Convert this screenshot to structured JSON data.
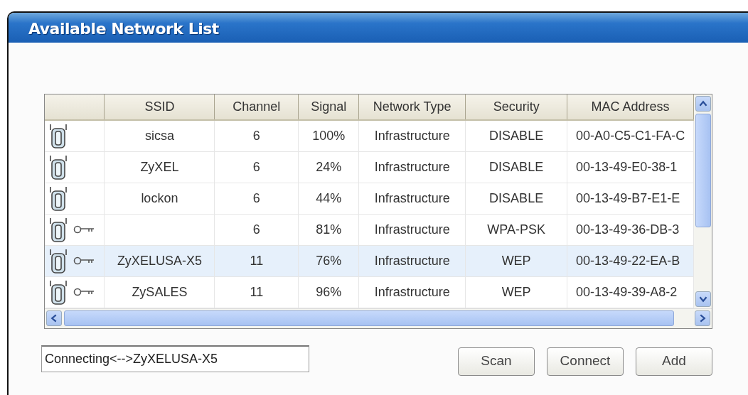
{
  "window": {
    "title": "Available Network List"
  },
  "table": {
    "columns": [
      "SSID",
      "Channel",
      "Signal",
      "Network Type",
      "Security",
      "MAC Address"
    ],
    "rows": [
      {
        "ssid": "sicsa",
        "channel": "6",
        "signal": "100%",
        "network_type": "Infrastructure",
        "security": "DISABLE",
        "mac": "00-A0-C5-C1-FA-C",
        "encrypted": false,
        "selected": false
      },
      {
        "ssid": "ZyXEL",
        "channel": "6",
        "signal": "24%",
        "network_type": "Infrastructure",
        "security": "DISABLE",
        "mac": "00-13-49-E0-38-1",
        "encrypted": false,
        "selected": false
      },
      {
        "ssid": "lockon",
        "channel": "6",
        "signal": "44%",
        "network_type": "Infrastructure",
        "security": "DISABLE",
        "mac": "00-13-49-B7-E1-E",
        "encrypted": false,
        "selected": false
      },
      {
        "channel": "6",
        "signal": "81%",
        "network_type": "Infrastructure",
        "security": "WPA-PSK",
        "mac": "00-13-49-36-DB-3",
        "encrypted": true,
        "selected": false
      },
      {
        "ssid": "ZyXELUSA-X5",
        "channel": "11",
        "signal": "76%",
        "network_type": "Infrastructure",
        "security": "WEP",
        "mac": "00-13-49-22-EA-B",
        "encrypted": true,
        "selected": true
      },
      {
        "ssid": "ZySALES",
        "channel": "11",
        "signal": "96%",
        "network_type": "Infrastructure",
        "security": "WEP",
        "mac": "00-13-49-39-A8-2",
        "encrypted": true,
        "selected": false
      }
    ]
  },
  "status": {
    "value": "Connecting<-->ZyXELUSA-X5"
  },
  "buttons": [
    "Scan",
    "Connect",
    "Add"
  ]
}
